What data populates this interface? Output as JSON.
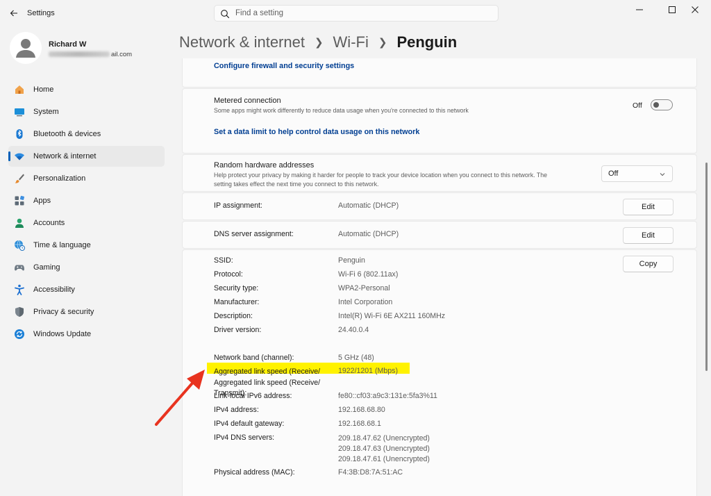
{
  "app": {
    "title": "Settings"
  },
  "search": {
    "placeholder": "Find a setting"
  },
  "profile": {
    "name": "Richard W",
    "email_suffix": "ail.com"
  },
  "sidebar": {
    "items": [
      {
        "label": "Home",
        "icon": "home-icon"
      },
      {
        "label": "System",
        "icon": "system-icon"
      },
      {
        "label": "Bluetooth & devices",
        "icon": "bluetooth-icon"
      },
      {
        "label": "Network & internet",
        "icon": "wifi-icon",
        "selected": true
      },
      {
        "label": "Personalization",
        "icon": "brush-icon"
      },
      {
        "label": "Apps",
        "icon": "apps-icon"
      },
      {
        "label": "Accounts",
        "icon": "accounts-icon"
      },
      {
        "label": "Time & language",
        "icon": "globe-clock-icon"
      },
      {
        "label": "Gaming",
        "icon": "gamepad-icon"
      },
      {
        "label": "Accessibility",
        "icon": "accessibility-icon"
      },
      {
        "label": "Privacy & security",
        "icon": "shield-icon"
      },
      {
        "label": "Windows Update",
        "icon": "update-icon"
      }
    ]
  },
  "breadcrumb": {
    "part1": "Network & internet",
    "part2": "Wi-Fi",
    "current": "Penguin"
  },
  "firewall_link": "Configure firewall and security settings",
  "metered": {
    "title": "Metered connection",
    "sub": "Some apps might work differently to reduce data usage when you're connected to this network",
    "toggle_label": "Off",
    "toggle_on": false,
    "limit_link": "Set a data limit to help control data usage on this network"
  },
  "random_hw": {
    "title": "Random hardware addresses",
    "sub1": "Help protect your privacy by making it harder for people to track your device location when you connect to this network. The",
    "sub2": "setting takes effect the next time you connect to this network.",
    "dropdown_value": "Off"
  },
  "ip_assignment": {
    "label": "IP assignment:",
    "value": "Automatic (DHCP)",
    "button": "Edit"
  },
  "dns_assignment": {
    "label": "DNS server assignment:",
    "value": "Automatic (DHCP)",
    "button": "Edit"
  },
  "properties": {
    "copy_button": "Copy",
    "ssid": {
      "label": "SSID:",
      "value": "Penguin"
    },
    "protocol": {
      "label": "Protocol:",
      "value": "Wi-Fi 6 (802.11ax)"
    },
    "security": {
      "label": "Security type:",
      "value": "WPA2-Personal"
    },
    "manufacturer": {
      "label": "Manufacturer:",
      "value": "Intel Corporation"
    },
    "description": {
      "label": "Description:",
      "value": "Intel(R) Wi-Fi 6E AX211 160MHz"
    },
    "driver": {
      "label": "Driver version:",
      "value": "24.40.0.4"
    },
    "band": {
      "label": "Network band (channel):",
      "value": "5 GHz (48)"
    },
    "link_speed": {
      "label1": "Aggregated link speed (Receive/",
      "label2": "Transmit):",
      "value": "1922/1201 (Mbps)"
    },
    "ipv6": {
      "label": "Link-local IPv6 address:",
      "value": "fe80::cf03:a9c3:131e:5fa3%11"
    },
    "ipv4": {
      "label": "IPv4 address:",
      "value": "192.168.68.80"
    },
    "gateway": {
      "label": "IPv4 default gateway:",
      "value": "192.168.68.1"
    },
    "dns": {
      "label": "IPv4 DNS servers:",
      "values": [
        "209.18.47.62 (Unencrypted)",
        "209.18.47.63 (Unencrypted)",
        "209.18.47.61 (Unencrypted)"
      ]
    },
    "mac": {
      "label": "Physical address (MAC):",
      "value": "F4:3B:D8:7A:51:AC"
    }
  },
  "colors": {
    "accent": "#005fb8",
    "link": "#003e92",
    "highlight": "#fff200",
    "arrow": "#e8331f"
  }
}
